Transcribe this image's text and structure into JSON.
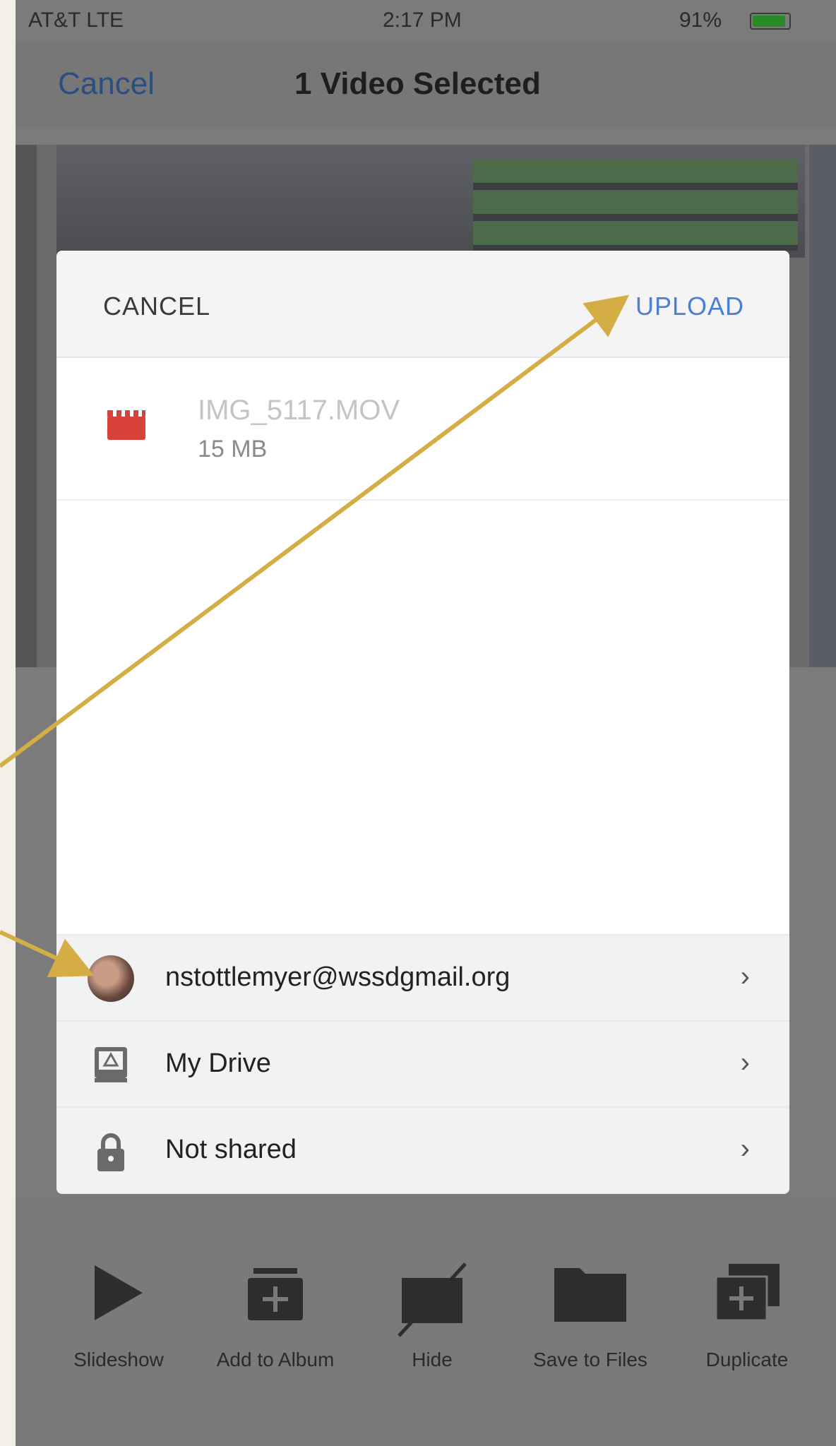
{
  "status_bar": {
    "carrier": "AT&T  LTE",
    "time": "2:17 PM",
    "battery": "91%",
    "battery_level": 0.91
  },
  "nav": {
    "cancel": "Cancel",
    "title": "1 Video Selected"
  },
  "sheet": {
    "cancel": "CANCEL",
    "upload": "UPLOAD",
    "file": {
      "name": "IMG_5117.MOV",
      "size": "15 MB",
      "icon": "video-clapper-icon"
    },
    "options": [
      {
        "label": "nstottlemyer@wssdgmail.org",
        "icon": "account-avatar"
      },
      {
        "label": "My Drive",
        "icon": "drive-icon"
      },
      {
        "label": "Not shared",
        "icon": "lock-icon"
      }
    ]
  },
  "toolbar": [
    {
      "label": "Slideshow",
      "icon": "play-icon"
    },
    {
      "label": "Add to Album",
      "icon": "add-album-icon"
    },
    {
      "label": "Hide",
      "icon": "hide-icon"
    },
    {
      "label": "Save to Files",
      "icon": "folder-icon"
    },
    {
      "label": "Duplicate",
      "icon": "duplicate-icon"
    }
  ],
  "colors": {
    "upload_accent": "#4a7fd6",
    "annotation_arrow": "#d4ae45",
    "file_icon": "#d9413b"
  }
}
